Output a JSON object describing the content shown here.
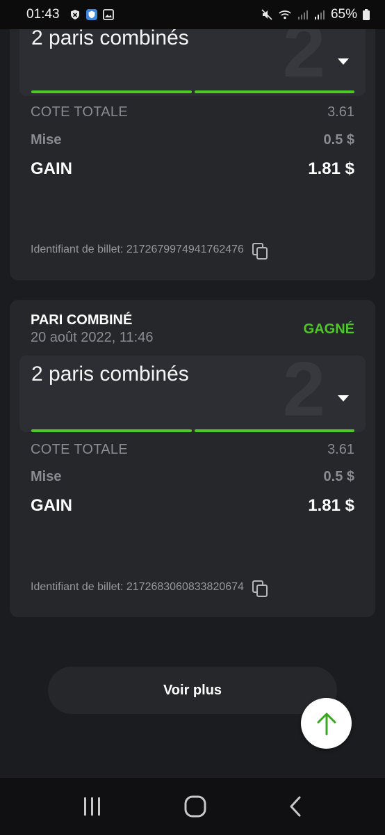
{
  "status_bar": {
    "time": "01:43",
    "battery": "65%",
    "left_icons": [
      "shield-icon",
      "security-shield-icon",
      "gallery-icon"
    ],
    "right_icons": [
      "mute-icon",
      "wifi-icon",
      "signal-icon",
      "signal-icon",
      "battery-icon"
    ]
  },
  "tickets": [
    {
      "combo_title": "2 paris combinés",
      "combo_count": "2",
      "cote_label": "COTE TOTALE",
      "cote_value": "3.61",
      "mise_label": "Mise",
      "mise_value": "0.5 $",
      "gain_label": "GAIN",
      "gain_value": "1.81 $",
      "ticket_id": "Identifiant de billet: 2172679974941762476"
    },
    {
      "type": "PARI COMBINÉ",
      "date": "20 août 2022, 11:46",
      "status": "GAGNÉ",
      "combo_title": "2 paris combinés",
      "combo_count": "2",
      "cote_label": "COTE TOTALE",
      "cote_value": "3.61",
      "mise_label": "Mise",
      "mise_value": "0.5 $",
      "gain_label": "GAIN",
      "gain_value": "1.81 $",
      "ticket_id": "Identifiant de billet: 2172683060833820674"
    }
  ],
  "voir_plus": "Voir plus",
  "colors": {
    "background": "#1b1c1f",
    "card": "#26272b",
    "accent_green": "#4ec827"
  },
  "nav": {
    "icons": [
      "recent-apps-icon",
      "home-icon",
      "back-icon"
    ]
  }
}
